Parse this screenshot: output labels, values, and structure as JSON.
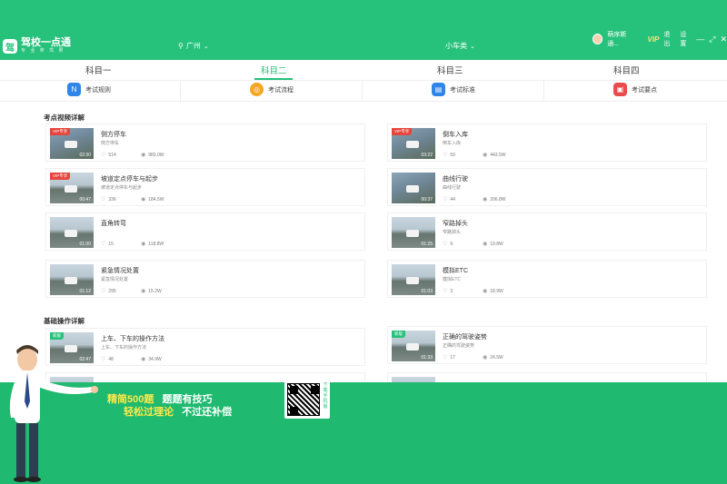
{
  "app": {
    "logo_char": "驾",
    "name": "驾校一点通",
    "slogan": "专 业 拿 驾 照"
  },
  "header": {
    "city": "广州",
    "car_type": "小车类",
    "user_name": "萌序斯通...",
    "vip": "VIP",
    "logout": "退出",
    "settings": "设置"
  },
  "tabs": [
    "科目一",
    "科目二",
    "科目三",
    "科目四"
  ],
  "subnav": [
    {
      "label": "考试规则",
      "icon": "rules-icon",
      "color": "#2f86e8"
    },
    {
      "label": "考试流程",
      "icon": "flow-icon",
      "color": "#f5a623"
    },
    {
      "label": "考试标准",
      "icon": "standard-icon",
      "color": "#2f86e8"
    },
    {
      "label": "考试要点",
      "icon": "points-icon",
      "color": "#ea4c4c"
    }
  ],
  "sections": {
    "exam_videos": "考点视频详解",
    "basic_ops": "基础操作详解"
  },
  "exam_videos": [
    {
      "title": "侧方停车",
      "sub": "侧方停车",
      "likes": "514",
      "views": "983.0W",
      "duration": "02:30",
      "badge": "VIP专享"
    },
    {
      "title": "倒车入库",
      "sub": "倒车入库",
      "likes": "59",
      "views": "443.5W",
      "duration": "03:22",
      "badge": "VIP专享"
    },
    {
      "title": "坡道定点停车与起步",
      "sub": "坡道定点停车与起步",
      "likes": "336",
      "views": "184.5W",
      "duration": "00:47",
      "badge": "VIP专享"
    },
    {
      "title": "曲线行驶",
      "sub": "曲线行驶",
      "likes": "44",
      "views": "206.8W",
      "duration": "00:37",
      "badge": ""
    },
    {
      "title": "直角转弯",
      "sub": "",
      "likes": "15",
      "views": "118.8W",
      "duration": "01:00",
      "badge": ""
    },
    {
      "title": "窄路掉头",
      "sub": "窄路掉头",
      "likes": "9",
      "views": "19.8W",
      "duration": "01:25",
      "badge": ""
    },
    {
      "title": "紧急情况处置",
      "sub": "紧急情况处置",
      "likes": "295",
      "views": "15.2W",
      "duration": "01:12",
      "badge": ""
    },
    {
      "title": "模拟ETC",
      "sub": "模拟ETC",
      "likes": "3",
      "views": "18.9W",
      "duration": "01:03",
      "badge": ""
    }
  ],
  "basic_videos": [
    {
      "title": "上车、下车的操作方法",
      "sub": "上车、下车的操作方法",
      "likes": "48",
      "views": "34.9W",
      "duration": "02:47",
      "badge": "新版"
    },
    {
      "title": "正确的驾驶姿势",
      "sub": "正确的驾驶姿势",
      "likes": "17",
      "views": "24.5W",
      "duration": "01:33",
      "badge": "新版"
    }
  ],
  "promo": {
    "line1_a": "精简500题",
    "line1_b": "题题有技巧",
    "line2_a": "轻松过理论",
    "line2_b": "不过还补偿",
    "qr_caption": "下载手机版"
  }
}
